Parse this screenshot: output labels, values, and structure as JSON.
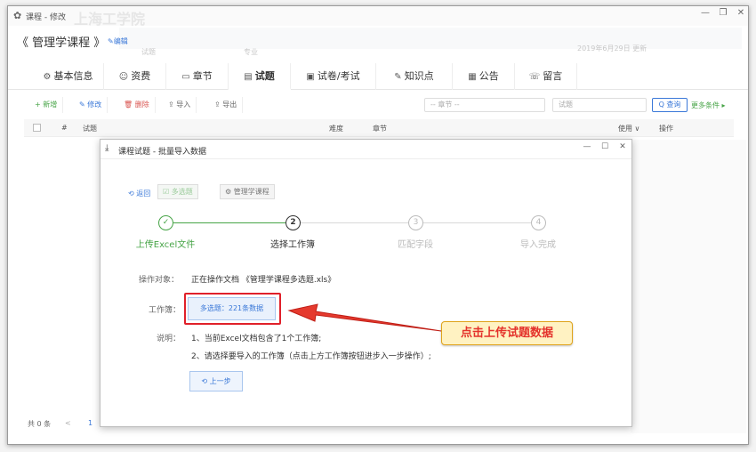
{
  "window": {
    "title": "课程 - 修改",
    "ghost_title": "上海工学院",
    "controls": [
      "—",
      "❐",
      "✕"
    ]
  },
  "header": {
    "course_title": "《 管理学课程 》",
    "edit_link": "✎编辑",
    "ghost_left": "试题",
    "ghost_mid": "专业",
    "ghost_right": "2019年6月29日 更新"
  },
  "tabs": [
    {
      "icon": "⚙",
      "label": "基本信息"
    },
    {
      "icon": "☺",
      "label": "资费"
    },
    {
      "icon": "▭",
      "label": "章节"
    },
    {
      "icon": "▤",
      "label": "试题"
    },
    {
      "icon": "▣",
      "label": "试卷/考试"
    },
    {
      "icon": "✎",
      "label": "知识点"
    },
    {
      "icon": "▦",
      "label": "公告"
    },
    {
      "icon": "☏",
      "label": "留言"
    }
  ],
  "toolbar": {
    "add": "+ 新增",
    "edit": "✎ 修改",
    "delete": "🗑 删除",
    "import": "⇪ 导入",
    "export": "⇪ 导出",
    "chapter_select": "-- 章节 --",
    "search_placeholder": "试题",
    "search_btn": "Q 查询",
    "more": "更多条件 ▸"
  },
  "table": {
    "headers": [
      "#",
      "试题",
      "难度",
      "章节",
      "使用 ∨",
      "操作"
    ]
  },
  "footer": {
    "total": "共 0 条",
    "prev": "<",
    "page": "1"
  },
  "modal": {
    "title": "课程试题 - 批量导入数据",
    "controls": [
      "—",
      "☐",
      "✕"
    ],
    "back": "⟲ 返回",
    "tag_type": "☑ 多选题",
    "tag_course": "⚙ 管理学课程",
    "steps": [
      {
        "num": "✓",
        "label": "上传Excel文件",
        "state": "done"
      },
      {
        "num": "2",
        "label": "选择工作簿",
        "state": "cur"
      },
      {
        "num": "3",
        "label": "匹配字段",
        "state": "todo"
      },
      {
        "num": "4",
        "label": "导入完成",
        "state": "todo"
      }
    ],
    "target_label": "操作对象：",
    "target_value": "正在操作文档 《管理学课程多选题.xls》",
    "workbook_label": "工作簿：",
    "workbook_btn": "多选题：221条数据",
    "desc_label": "说明：",
    "desc_1": "1、当前Excel文档包含了1个工作簿;",
    "desc_2": "2、请选择要导入的工作簿（点击上方工作簿按钮进步入一步操作）;",
    "prev_btn": "⟲ 上一步"
  },
  "callout": {
    "text": "点击上传试题数据"
  }
}
